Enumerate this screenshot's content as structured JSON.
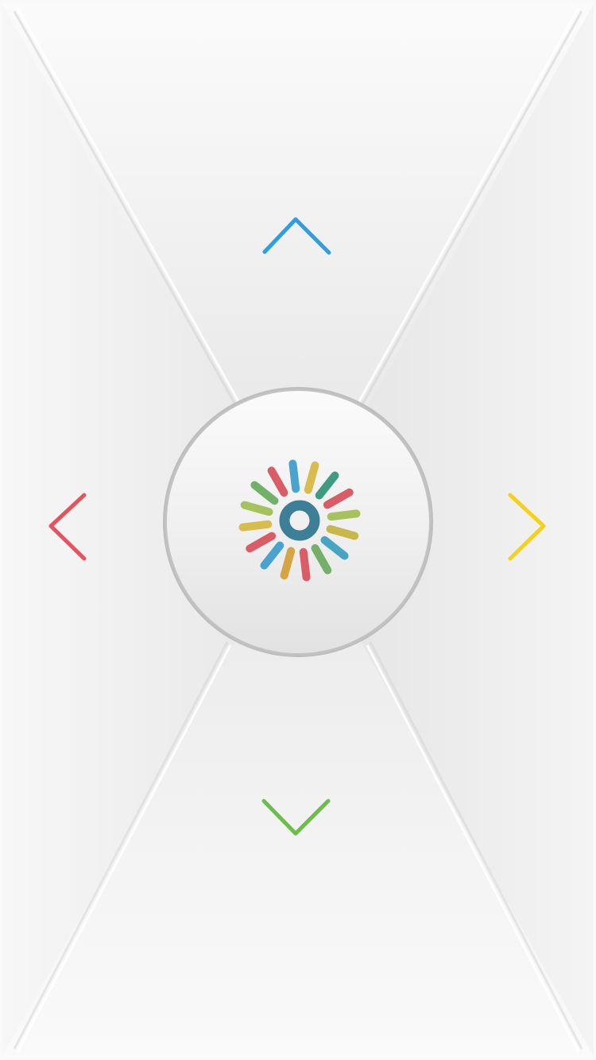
{
  "remote": {
    "up": {
      "icon": "chevron-up-icon",
      "color": "#2f9fe0"
    },
    "down": {
      "icon": "chevron-down-icon",
      "color": "#6abf4b"
    },
    "left": {
      "icon": "chevron-left-icon",
      "color": "#e5535e"
    },
    "right": {
      "icon": "chevron-right-icon",
      "color": "#f4d21c"
    },
    "center": {
      "icon": "sunburst-logo-icon",
      "ring_color": "#3d7f97",
      "ray_colors": [
        "#4aa2cf",
        "#d8bc4d",
        "#3f9c82",
        "#d95c67",
        "#a5c25c",
        "#c8b84c",
        "#47a5c4",
        "#73b06a",
        "#d95c67",
        "#d3a543",
        "#4aa2cf",
        "#d95c67",
        "#d8bc4d",
        "#a5c25c",
        "#73b06a",
        "#d95c67"
      ]
    }
  }
}
